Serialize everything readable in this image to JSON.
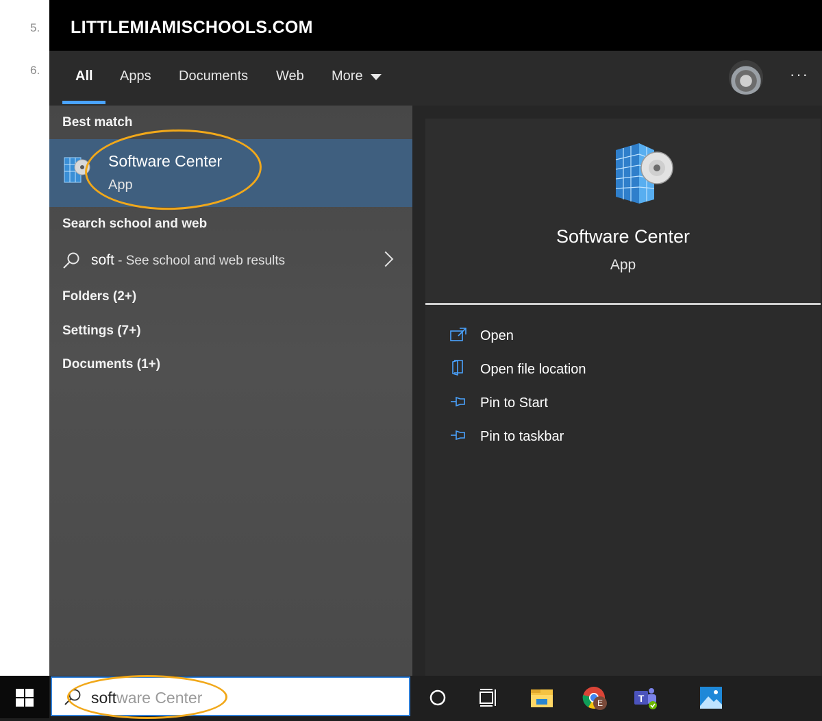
{
  "doc": {
    "step_numbers": [
      "5.",
      "6."
    ]
  },
  "header": {
    "brand": "LITTLEMIAMISCHOOLS.COM"
  },
  "nav": {
    "tabs": [
      {
        "label": "All",
        "active": true
      },
      {
        "label": "Apps"
      },
      {
        "label": "Documents"
      },
      {
        "label": "Web"
      },
      {
        "label": "More"
      }
    ],
    "more_icon": "chevron-down-icon",
    "overflow": "···",
    "accent": "#4aa3ff"
  },
  "results": {
    "best_match_heading": "Best match",
    "best_match": {
      "title": "Software Center",
      "subtitle": "App"
    },
    "search_web_heading": "Search school and web",
    "search_web": {
      "query": "soft",
      "hint": " - See school and web results"
    },
    "folders": "Folders (2+)",
    "settings": "Settings (7+)",
    "documents": "Documents (1+)"
  },
  "detail": {
    "title": "Software Center",
    "subtitle": "App",
    "actions": [
      {
        "label": "Open",
        "icon": "open-icon"
      },
      {
        "label": "Open file location",
        "icon": "folder-location-icon"
      },
      {
        "label": "Pin to Start",
        "icon": "pin-icon"
      },
      {
        "label": "Pin to taskbar",
        "icon": "pin-icon"
      }
    ]
  },
  "taskbar": {
    "search_typed": "soft",
    "search_suggestion": "ware Center",
    "icons": [
      "cortana-icon",
      "task-view-icon",
      "file-explorer-icon",
      "chrome-icon",
      "teams-icon",
      "photos-icon"
    ],
    "chrome_badge": "E"
  },
  "colors": {
    "highlight": "#3f5f7f",
    "annotation": "#f1a81a"
  }
}
